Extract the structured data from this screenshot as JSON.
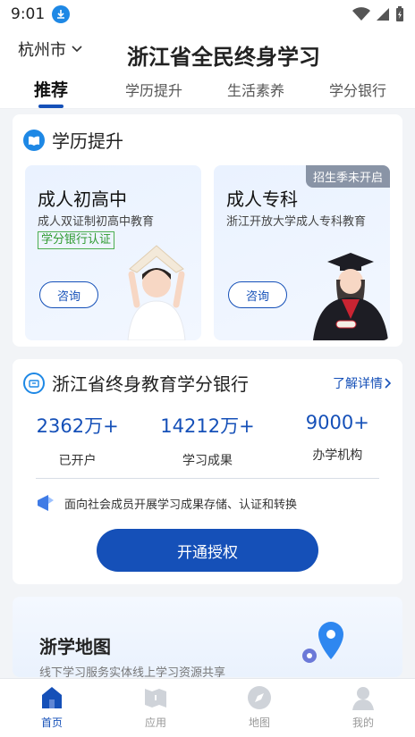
{
  "status_bar": {
    "time": "9:01"
  },
  "header": {
    "city": "杭州市",
    "title": "浙江省全民终身学习"
  },
  "tabs": [
    {
      "label": "推荐",
      "active": true
    },
    {
      "label": "学历提升",
      "active": false
    },
    {
      "label": "生活素养",
      "active": false
    },
    {
      "label": "学分银行",
      "active": false
    }
  ],
  "education": {
    "title": "学历提升",
    "cards": [
      {
        "name": "成人初高中",
        "desc": "成人双证制初高中教育",
        "badge": "学分银行认证",
        "button": "咨询"
      },
      {
        "name": "成人专科",
        "desc": "浙江开放大学成人专科教育",
        "ribbon": "招生季未开启",
        "button": "咨询"
      }
    ]
  },
  "credit_bank": {
    "title": "浙江省终身教育学分银行",
    "detail_link": "了解详情",
    "stats": [
      {
        "value": "2362万+",
        "label": "已开户"
      },
      {
        "value": "14212万+",
        "label": "学习成果"
      },
      {
        "value": "9000+",
        "label": "办学机构"
      }
    ],
    "description": "面向社会成员开展学习成果存储、认证和转换",
    "open_button": "开通授权"
  },
  "map_section": {
    "title": "浙学地图",
    "subtitle": "线下学习服务实体线上学习资源共享"
  },
  "bottom_nav": [
    {
      "label": "首页",
      "icon": "home-icon",
      "active": true
    },
    {
      "label": "应用",
      "icon": "apps-icon",
      "active": false
    },
    {
      "label": "地图",
      "icon": "compass-icon",
      "active": false
    },
    {
      "label": "我的",
      "icon": "profile-icon",
      "active": false
    }
  ],
  "colors": {
    "primary": "#1550b8",
    "accent": "#1e88e5",
    "badge_green": "#2f9a2f"
  }
}
